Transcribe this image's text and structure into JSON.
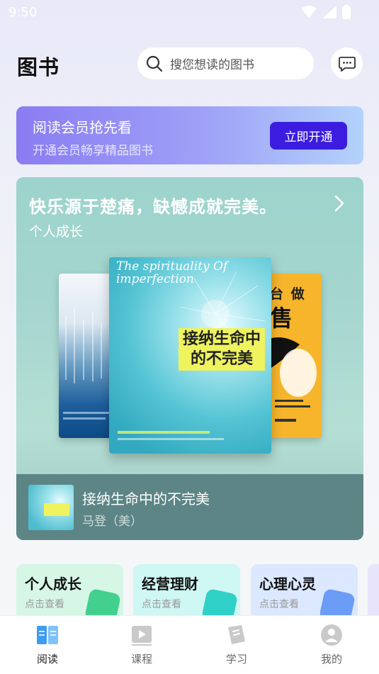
{
  "status_bar": {
    "time": "9:50"
  },
  "header": {
    "title": "图书",
    "search_placeholder": "搜您想读的图书"
  },
  "vip_banner": {
    "title": "阅读会员抢先看",
    "subtitle": "开通会员畅享精品图书",
    "button_label": "立即开通"
  },
  "featured": {
    "quote": "快乐源于楚痛，缺憾成就完美。",
    "category": "个人成长",
    "covers": {
      "main_title": "接纳生命中的不完美",
      "main_script": "The spirituality Of imperfection",
      "right_text_1": "台 做",
      "right_text_2": "售"
    },
    "book_title": "接纳生命中的不完美",
    "book_author": "马登（美）"
  },
  "categories": [
    {
      "name": "个人成长",
      "hint": "点击查看",
      "bg": "#d6f6e6",
      "icon_color": "#43d08f"
    },
    {
      "name": "经营理财",
      "hint": "点击查看",
      "bg": "#cff7f3",
      "icon_color": "#2fd1c6"
    },
    {
      "name": "心理心灵",
      "hint": "点击查看",
      "bg": "#dbe8ff",
      "icon_color": "#6b9cf6"
    },
    {
      "name": "",
      "hint": "",
      "bg": "#e7e4fb",
      "icon_color": "#9e8cf0"
    }
  ],
  "tabs": [
    {
      "label": "阅读",
      "icon": "book-icon",
      "active": true
    },
    {
      "label": "课程",
      "icon": "video-icon",
      "active": false
    },
    {
      "label": "学习",
      "icon": "study-icon",
      "active": false
    },
    {
      "label": "我的",
      "icon": "profile-icon",
      "active": false
    }
  ],
  "colors": {
    "accent": "#3c1de0",
    "tab_active": "#3d9cf0"
  }
}
